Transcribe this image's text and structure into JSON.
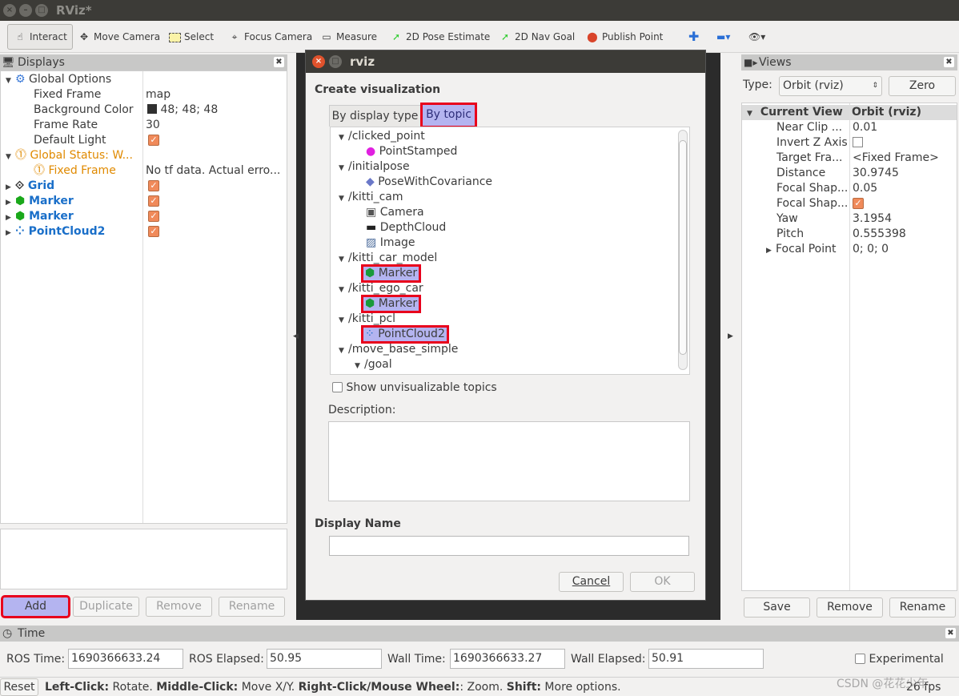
{
  "window": {
    "title": "RViz*"
  },
  "toolbar": {
    "tools": [
      {
        "label": "Interact",
        "icon": "hand-icon"
      },
      {
        "label": "Move Camera",
        "icon": "move-icon"
      },
      {
        "label": "Select",
        "icon": "select-icon"
      },
      {
        "label": "Focus Camera",
        "icon": "focus-icon"
      },
      {
        "label": "Measure",
        "icon": "ruler-icon"
      },
      {
        "label": "2D Pose Estimate",
        "icon": "green-arrow-icon"
      },
      {
        "label": "2D Nav Goal",
        "icon": "green-arrow-icon"
      },
      {
        "label": "Publish Point",
        "icon": "pin-icon"
      }
    ]
  },
  "displays": {
    "title": "Displays",
    "rows": [
      {
        "name": "Global Options",
        "value": ""
      },
      {
        "name": "Fixed Frame",
        "value": "map"
      },
      {
        "name": "Background Color",
        "value": "48; 48; 48"
      },
      {
        "name": "Frame Rate",
        "value": "30"
      },
      {
        "name": "Default Light",
        "value": ""
      },
      {
        "name": "Global Status: W...",
        "value": ""
      },
      {
        "name": "Fixed Frame",
        "value": "No tf data.  Actual erro..."
      },
      {
        "name": "Grid",
        "value": ""
      },
      {
        "name": "Marker",
        "value": ""
      },
      {
        "name": "Marker",
        "value": ""
      },
      {
        "name": "PointCloud2",
        "value": ""
      }
    ],
    "buttons": {
      "add": "Add",
      "duplicate": "Duplicate",
      "remove": "Remove",
      "rename": "Rename"
    }
  },
  "dialog": {
    "title": "rviz",
    "heading": "Create visualization",
    "tabs": [
      "By display type",
      "By topic"
    ],
    "topics": [
      {
        "label": "/clicked_point",
        "level": 0
      },
      {
        "label": "PointStamped",
        "level": 1,
        "icon": "point-icon"
      },
      {
        "label": "/initialpose",
        "level": 0
      },
      {
        "label": "PoseWithCovariance",
        "level": 1,
        "icon": "pose-icon"
      },
      {
        "label": "/kitti_cam",
        "level": 0
      },
      {
        "label": "Camera",
        "level": 1,
        "icon": "camera-icon"
      },
      {
        "label": "DepthCloud",
        "level": 1,
        "icon": "depth-icon"
      },
      {
        "label": "Image",
        "level": 1,
        "icon": "image-icon"
      },
      {
        "label": "/kitti_car_model",
        "level": 0
      },
      {
        "label": "Marker",
        "level": 1,
        "icon": "marker-icon",
        "selected": true
      },
      {
        "label": "/kitti_ego_car",
        "level": 0
      },
      {
        "label": "Marker",
        "level": 1,
        "icon": "marker-icon",
        "selected": true
      },
      {
        "label": "/kitti_pcl",
        "level": 0
      },
      {
        "label": "PointCloud2",
        "level": 1,
        "icon": "pointcloud-icon",
        "selected": true
      },
      {
        "label": "/move_base_simple",
        "level": 0
      },
      {
        "label": "/goal",
        "level": 1,
        "expand": true
      }
    ],
    "show_unvisualizable": "Show unvisualizable topics",
    "description_label": "Description:",
    "display_name_label": "Display Name",
    "display_name_value": "",
    "cancel": "Cancel",
    "ok": "OK"
  },
  "views": {
    "title": "Views",
    "type_label": "Type:",
    "type_value": "Orbit (rviz)",
    "zero": "Zero",
    "header": [
      "Current View",
      "Orbit (rviz)"
    ],
    "rows": [
      {
        "name": "Near Clip ...",
        "value": "0.01"
      },
      {
        "name": "Invert Z Axis",
        "value": ""
      },
      {
        "name": "Target Fra...",
        "value": "<Fixed Frame>"
      },
      {
        "name": "Distance",
        "value": "30.9745"
      },
      {
        "name": "Focal Shap...",
        "value": "0.05"
      },
      {
        "name": "Focal Shap...",
        "value": ""
      },
      {
        "name": "Yaw",
        "value": "3.1954"
      },
      {
        "name": "Pitch",
        "value": "0.555398"
      },
      {
        "name": "Focal Point",
        "value": "0; 0; 0"
      }
    ],
    "buttons": {
      "save": "Save",
      "remove": "Remove",
      "rename": "Rename"
    }
  },
  "time": {
    "title": "Time",
    "ros_time_label": "ROS Time:",
    "ros_time": "1690366633.24",
    "ros_elapsed_label": "ROS Elapsed:",
    "ros_elapsed": "50.95",
    "wall_time_label": "Wall Time:",
    "wall_time": "1690366633.27",
    "wall_elapsed_label": "Wall Elapsed:",
    "wall_elapsed": "50.91",
    "experimental": "Experimental"
  },
  "status": {
    "reset": "Reset",
    "b1": "Left-Click:",
    "t1": " Rotate. ",
    "b2": "Middle-Click:",
    "t2": " Move X/Y. ",
    "b3": "Right-Click/Mouse Wheel:",
    "t3": ": Zoom. ",
    "b4": "Shift:",
    "t4": " More options.",
    "fps": "26 fps",
    "watermark": "CSDN @花花少年"
  },
  "colors": {
    "selection": "#b4b4f0",
    "highlight_box": "#e8001c",
    "link_blue": "#1a6fc9",
    "warning": "#e08a00"
  }
}
